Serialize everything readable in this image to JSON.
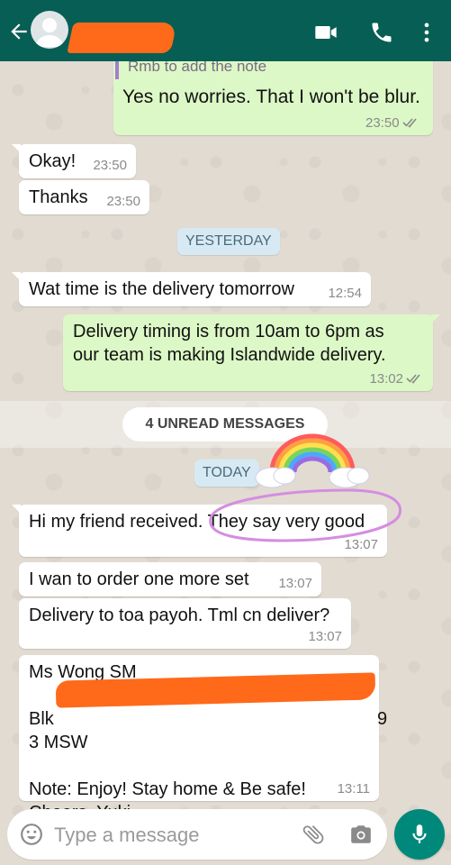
{
  "header": {
    "back_icon": "arrow-left-icon",
    "avatar_icon": "default-avatar-icon",
    "contact_name_redacted": true,
    "video_icon": "video-call-icon",
    "call_icon": "phone-call-icon",
    "menu_icon": "more-vert-icon",
    "color": "#075e54"
  },
  "messages": {
    "quoted_note": "Rmb to add the note",
    "m1": {
      "text": "Yes no worries. That I won't be blur.",
      "time": "23:50",
      "status": "read"
    },
    "m2": {
      "text": "Okay!",
      "time": "23:50"
    },
    "m3": {
      "text": "Thanks",
      "time": "23:50"
    },
    "date_yesterday": "YESTERDAY",
    "m4": {
      "text": "Wat time is the delivery tomorrow",
      "time": "12:54"
    },
    "m5": {
      "text": "Delivery timing is from 10am to 6pm as\nour team is making Islandwide delivery.",
      "time": "13:02",
      "status": "read"
    },
    "unread_label": "4 UNREAD MESSAGES",
    "date_today": "TODAY",
    "m6": {
      "text": "Hi my friend received. They say very good",
      "time": "13:07"
    },
    "m7": {
      "text": "I wan to order one more set",
      "time": "13:07"
    },
    "m8": {
      "text": "Delivery to toa payoh. Tml cn deliver?",
      "time": "13:07"
    },
    "m9": {
      "line1": "Ms Wong SM",
      "line2_prefix": "Blk",
      "line2_suffix": "9",
      "line3": "3 MSW",
      "line4": "Note: Enjoy! Stay home & Be safe!",
      "line5": "Cheers, Yuki",
      "time": "13:11"
    }
  },
  "input": {
    "placeholder": "Type a message",
    "emoji_icon": "emoji-icon",
    "attach_icon": "paperclip-icon",
    "camera_icon": "camera-icon",
    "mic_icon": "mic-icon"
  },
  "colors": {
    "outgoing_bubble": "#dcf8c6",
    "incoming_bubble": "#ffffff",
    "accent": "#00897b",
    "read_ticks": "#8a8a8a",
    "redaction": "#ff6a1a",
    "highlight_circle": "#d58de0"
  }
}
